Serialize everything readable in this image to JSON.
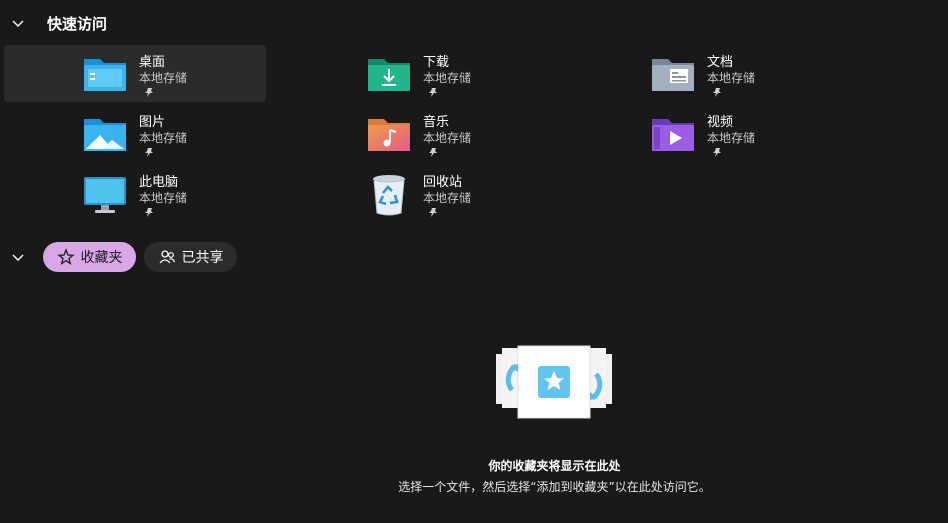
{
  "quick_access": {
    "title": "快速访问",
    "items": [
      {
        "name": "桌面",
        "location": "本地存储",
        "icon": "desktop-folder-icon"
      },
      {
        "name": "下载",
        "location": "本地存储",
        "icon": "downloads-folder-icon"
      },
      {
        "name": "文档",
        "location": "本地存储",
        "icon": "documents-folder-icon"
      },
      {
        "name": "图片",
        "location": "本地存储",
        "icon": "pictures-folder-icon"
      },
      {
        "name": "音乐",
        "location": "本地存储",
        "icon": "music-folder-icon"
      },
      {
        "name": "视频",
        "location": "本地存储",
        "icon": "videos-folder-icon"
      },
      {
        "name": "此电脑",
        "location": "本地存储",
        "icon": "this-pc-icon"
      },
      {
        "name": "回收站",
        "location": "本地存储",
        "icon": "recycle-bin-icon"
      }
    ]
  },
  "tabs": {
    "favorites_label": "收藏夹",
    "shared_label": "已共享"
  },
  "empty_state": {
    "title": "你的收藏夹将显示在此处",
    "description": "选择一个文件，然后选择“添加到收藏夹”以在此处访问它。"
  },
  "colors": {
    "background": "#191919",
    "active_pill": "#d9a6e8",
    "selected_tile": "#2b2b2b"
  }
}
